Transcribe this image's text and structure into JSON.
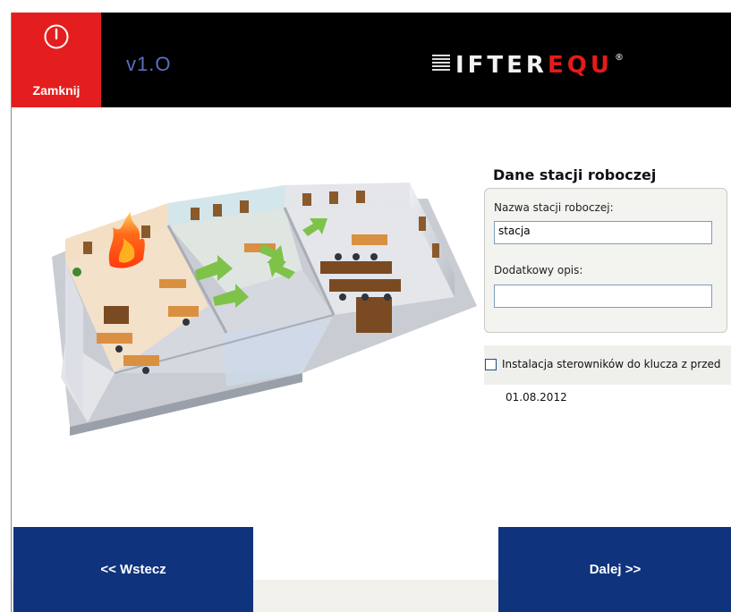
{
  "header": {
    "close_label": "Zamknij",
    "close_icon": "power-icon",
    "version": "v1.O",
    "logo": {
      "part1": "IFTER",
      "part2": "EQU",
      "reg": "®"
    },
    "colors": {
      "close_bg": "#e41e1e",
      "header_bg": "#000000",
      "logo_accent": "#e31b1b",
      "version": "#5b6fc0"
    }
  },
  "illustration": {
    "name": "office-building-fire-illustration"
  },
  "form": {
    "section_title": "Dane stacji roboczej",
    "station_name_label": "Nazwa stacji roboczej:",
    "station_name_value": "stacja",
    "description_label": "Dodatkowy opis:",
    "description_value": ""
  },
  "driver": {
    "checkbox_label": "Instalacja sterowników do klucza z przed",
    "checked": false,
    "date": "01.08.2012"
  },
  "nav": {
    "back_label": "<< Wstecz",
    "next_label": "Dalej >>",
    "button_color": "#10337d"
  }
}
